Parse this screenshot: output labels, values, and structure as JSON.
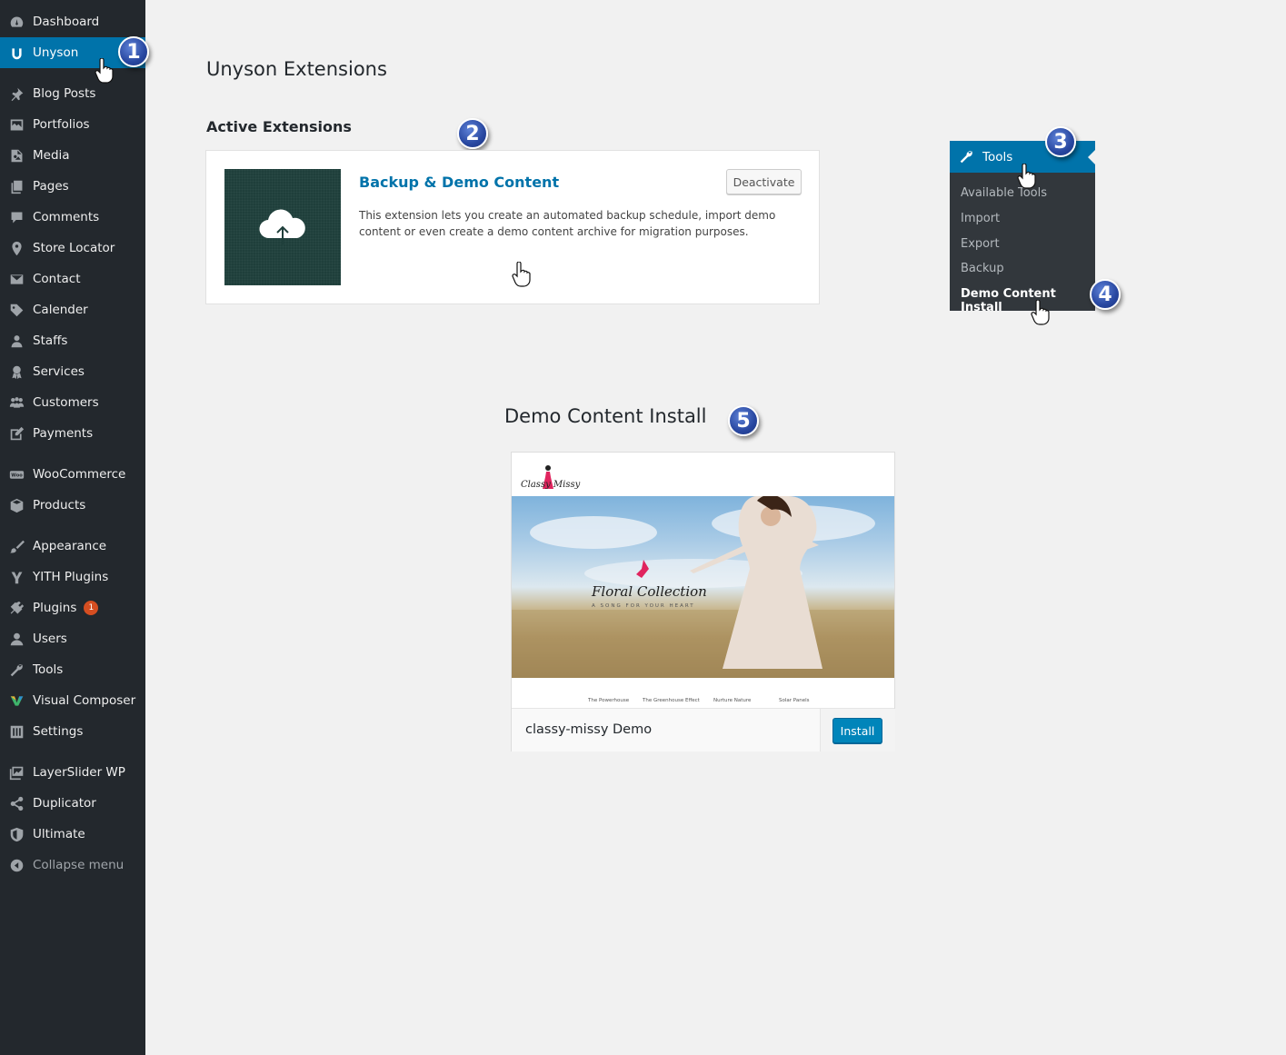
{
  "sidebar": {
    "items": [
      {
        "label": "Dashboard",
        "icon": "dashboard-icon"
      },
      {
        "label": "Unyson",
        "icon": "unyson-icon"
      },
      {
        "label": "Blog Posts",
        "icon": "pin-icon"
      },
      {
        "label": "Portfolios",
        "icon": "portfolio-icon"
      },
      {
        "label": "Media",
        "icon": "media-icon"
      },
      {
        "label": "Pages",
        "icon": "pages-icon"
      },
      {
        "label": "Comments",
        "icon": "comments-icon"
      },
      {
        "label": "Store Locator",
        "icon": "location-icon"
      },
      {
        "label": "Contact",
        "icon": "email-icon"
      },
      {
        "label": "Calender",
        "icon": "tag-icon"
      },
      {
        "label": "Staffs",
        "icon": "user-group-icon"
      },
      {
        "label": "Services",
        "icon": "award-icon"
      },
      {
        "label": "Customers",
        "icon": "groups-icon"
      },
      {
        "label": "Payments",
        "icon": "edit-icon"
      },
      {
        "label": "WooCommerce",
        "icon": "woo-icon"
      },
      {
        "label": "Products",
        "icon": "box-icon"
      },
      {
        "label": "Appearance",
        "icon": "brush-icon"
      },
      {
        "label": "YITH Plugins",
        "icon": "yith-icon"
      },
      {
        "label": "Plugins",
        "icon": "plugin-icon",
        "badge": "1"
      },
      {
        "label": "Users",
        "icon": "user-icon"
      },
      {
        "label": "Tools",
        "icon": "wrench-icon"
      },
      {
        "label": "Visual Composer",
        "icon": "vc-icon"
      },
      {
        "label": "Settings",
        "icon": "settings-icon"
      },
      {
        "label": "LayerSlider WP",
        "icon": "slides-icon"
      },
      {
        "label": "Duplicator",
        "icon": "share-icon"
      },
      {
        "label": "Ultimate",
        "icon": "shield-icon"
      },
      {
        "label": "Collapse menu",
        "icon": "collapse-icon"
      }
    ]
  },
  "markers": {
    "m1": "1",
    "m2": "2",
    "m3": "3",
    "m4": "4",
    "m5": "5"
  },
  "extensions": {
    "page_title": "Unyson Extensions",
    "section_title": "Active Extensions",
    "card": {
      "title": "Backup & Demo Content",
      "description": "This extension lets you create an automated backup schedule, import demo content or even create a demo content archive for migration purposes.",
      "action": "Deactivate"
    }
  },
  "tools_menu": {
    "title": "Tools",
    "items": [
      "Available Tools",
      "Import",
      "Export",
      "Backup",
      "Demo Content Install"
    ]
  },
  "demo": {
    "section_title": "Demo Content Install",
    "logo": "Classy Missy",
    "hero_title": "Floral Collection",
    "hero_subtitle": "A SONG FOR YOUR HEART",
    "strip_labels": [
      "The Powerhouse",
      "The Greenhouse Effect",
      "Nurture Nature",
      "Solar Panels"
    ],
    "name": "classy-missy Demo",
    "install_label": "Install"
  },
  "colors": {
    "accent": "#0073aa",
    "sidebar_bg": "#23282d",
    "badge": "#d54e21",
    "page_bg": "#f1f1f1"
  }
}
